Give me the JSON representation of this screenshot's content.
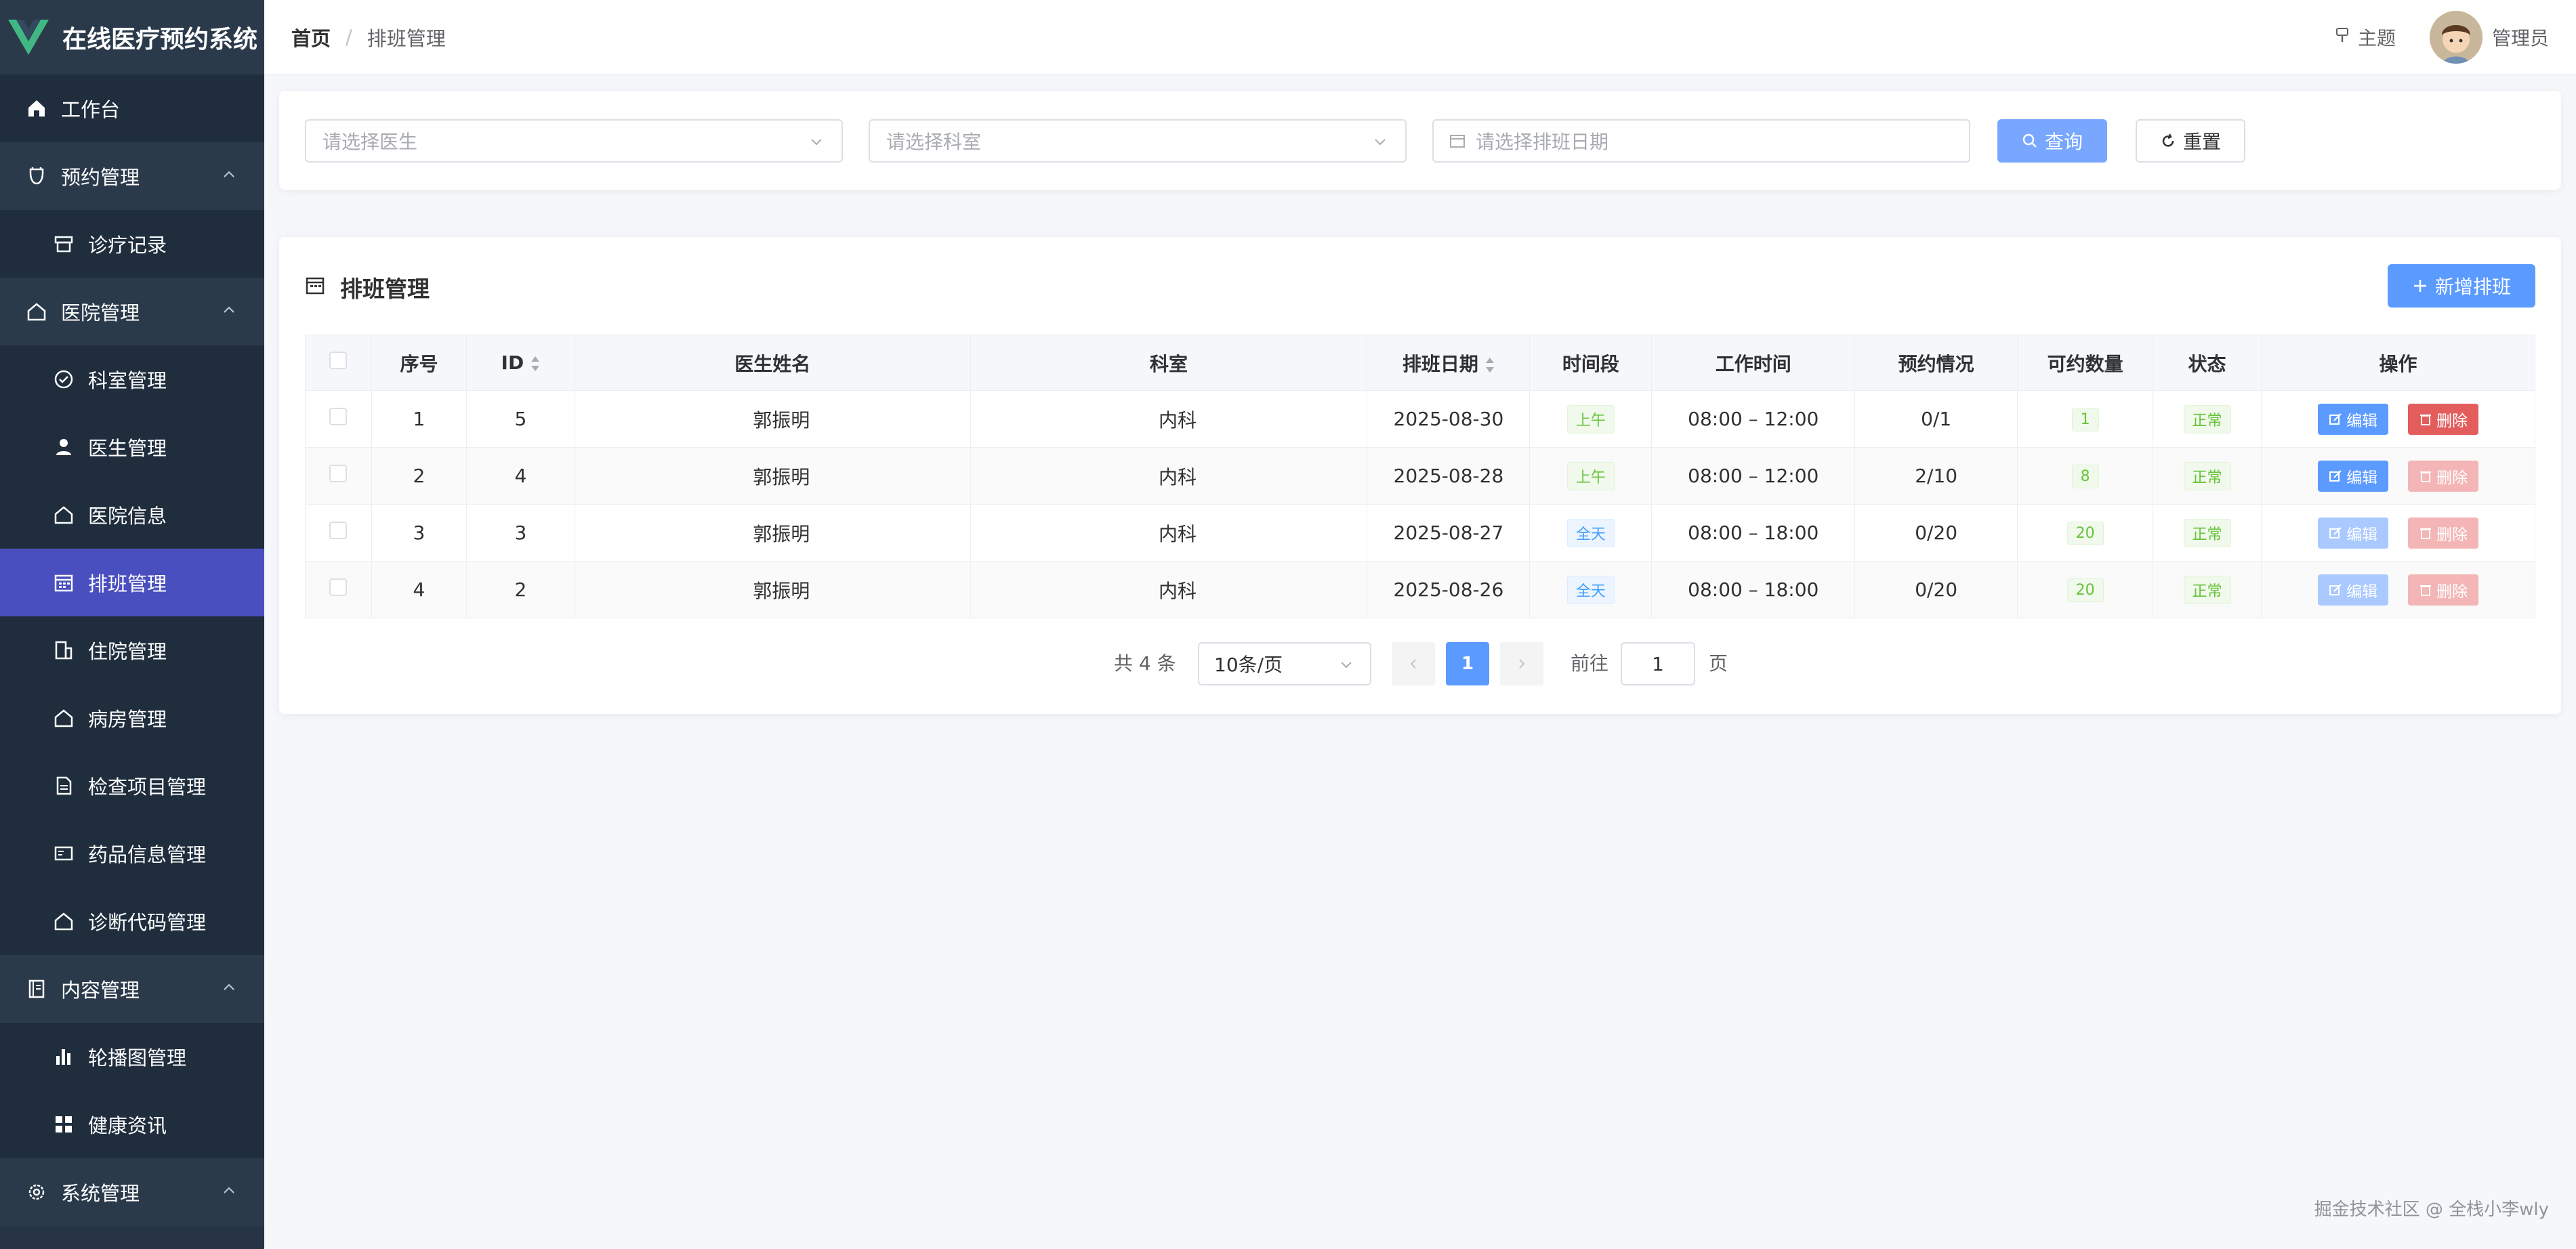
{
  "app": {
    "title": "在线医疗预约系统"
  },
  "sidebar": {
    "items": [
      {
        "label": "工作台"
      },
      {
        "label": "预约管理"
      },
      {
        "label": "诊疗记录"
      },
      {
        "label": "医院管理"
      },
      {
        "label": "科室管理"
      },
      {
        "label": "医生管理"
      },
      {
        "label": "医院信息"
      },
      {
        "label": "排班管理"
      },
      {
        "label": "住院管理"
      },
      {
        "label": "病房管理"
      },
      {
        "label": "检查项目管理"
      },
      {
        "label": "药品信息管理"
      },
      {
        "label": "诊断代码管理"
      },
      {
        "label": "内容管理"
      },
      {
        "label": "轮播图管理"
      },
      {
        "label": "健康资讯"
      },
      {
        "label": "系统管理"
      }
    ]
  },
  "header": {
    "breadcrumb_home": "首页",
    "breadcrumb_sep": "/",
    "breadcrumb_current": "排班管理",
    "theme_label": "主题",
    "user_name": "管理员"
  },
  "search": {
    "doctor_placeholder": "请选择医生",
    "dept_placeholder": "请选择科室",
    "date_placeholder": "请选择排班日期",
    "query_label": "查询",
    "reset_label": "重置"
  },
  "card": {
    "title": "排班管理",
    "add_label": "新增排班"
  },
  "table": {
    "headers": [
      "序号",
      "ID",
      "医生姓名",
      "科室",
      "排班日期",
      "时间段",
      "工作时间",
      "预约情况",
      "可约数量",
      "状态",
      "操作"
    ],
    "rows": [
      {
        "index": "1",
        "id": "5",
        "doctor": "郭振明",
        "dept": "内科",
        "date": "2025-08-30",
        "period": "上午",
        "hours": "08:00 – 12:00",
        "booking": "0/1",
        "available": "1",
        "status": "正常"
      },
      {
        "index": "2",
        "id": "4",
        "doctor": "郭振明",
        "dept": "内科",
        "date": "2025-08-28",
        "period": "上午",
        "hours": "08:00 – 12:00",
        "booking": "2/10",
        "available": "8",
        "status": "正常"
      },
      {
        "index": "3",
        "id": "3",
        "doctor": "郭振明",
        "dept": "内科",
        "date": "2025-08-27",
        "period": "全天",
        "hours": "08:00 – 18:00",
        "booking": "0/20",
        "available": "20",
        "status": "正常"
      },
      {
        "index": "4",
        "id": "2",
        "doctor": "郭振明",
        "dept": "内科",
        "date": "2025-08-26",
        "period": "全天",
        "hours": "08:00 – 18:00",
        "booking": "0/20",
        "available": "20",
        "status": "正常"
      }
    ],
    "edit_label": "编辑",
    "delete_label": "删除"
  },
  "pager": {
    "total": "共 4 条",
    "page_size": "10条/页",
    "current_page": "1",
    "goto_label": "前往",
    "goto_value": "1",
    "page_unit": "页"
  },
  "watermark": "掘金技术社区 @ 全栈小李wly",
  "colors": {
    "primary": "#5b9bff",
    "sidebar_bg": "#263445",
    "active": "#4a4fbf",
    "danger": "#e45d5d",
    "success": "#67c23a"
  }
}
